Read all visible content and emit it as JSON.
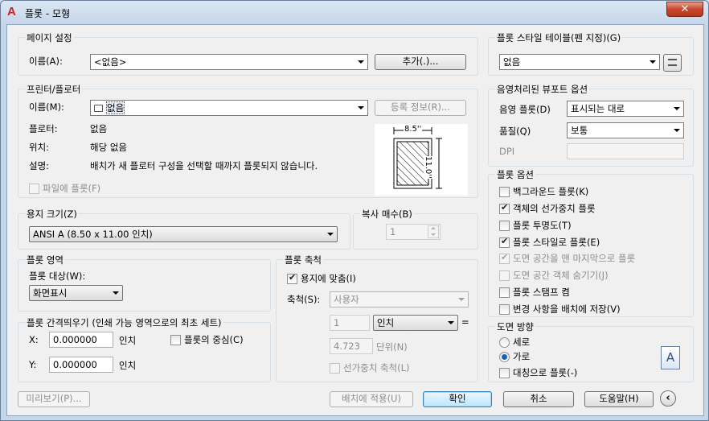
{
  "window": {
    "title": "플롯 - 모형",
    "app_icon": "A",
    "close_label": "✕"
  },
  "page_setup": {
    "group": "페이지 설정",
    "name_label": "이름(A):",
    "name_value": "<없음>",
    "add_button": "추가(.)..."
  },
  "plot_style": {
    "group": "플롯 스타일 테이블(펜 지정)(G)",
    "value": "없음"
  },
  "printer": {
    "group": "프린터/플로터",
    "name_label": "이름(M):",
    "name_value": "없음",
    "properties_button": "등록 정보(R)...",
    "plotter_label": "플로터:",
    "plotter_value": "없음",
    "location_label": "위치:",
    "location_value": "해당 없음",
    "description_label": "설명:",
    "description_value": "배치가 새 플로터 구성을 선택할 때까지 플롯되지 않습니다.",
    "plot_to_file": "파일에 플롯(F)",
    "preview_width": "8.5''",
    "preview_height": "11.0''"
  },
  "shaded": {
    "group": "음영처리된 뷰포트 옵션",
    "shade_label": "음영 플롯(D)",
    "shade_value": "표시되는 대로",
    "quality_label": "품질(Q)",
    "quality_value": "보통",
    "dpi_label": "DPI",
    "dpi_value": ""
  },
  "plot_options": {
    "group": "플롯 옵션",
    "items": [
      {
        "label": "백그라운드 플롯(K)",
        "checked": false,
        "enabled": true
      },
      {
        "label": "객체의 선가중치 플롯",
        "checked": true,
        "enabled": true
      },
      {
        "label": "플롯 투명도(T)",
        "checked": false,
        "enabled": true
      },
      {
        "label": "플롯 스타일로 플롯(E)",
        "checked": true,
        "enabled": true
      },
      {
        "label": "도면 공간을 맨 마지막으로 플롯",
        "checked": true,
        "enabled": false
      },
      {
        "label": "도면 공간 객체 숨기기(J)",
        "checked": false,
        "enabled": false
      },
      {
        "label": "플롯 스탬프 켬",
        "checked": false,
        "enabled": true
      },
      {
        "label": "변경 사항을 배치에 저장(V)",
        "checked": false,
        "enabled": true
      }
    ]
  },
  "paper_size": {
    "group": "용지 크기(Z)",
    "value": "ANSI A (8.50 x 11.00 인치)"
  },
  "copies": {
    "group": "복사 매수(B)",
    "value": "1"
  },
  "plot_area": {
    "group": "플롯 영역",
    "what_label": "플롯 대상(W):",
    "what_value": "화면표시"
  },
  "plot_scale": {
    "group": "플롯 축척",
    "fit_label": "용지에 맞춤(I)",
    "fit_checked": true,
    "scale_label": "축척(S):",
    "scale_value": "사용자",
    "value1": "1",
    "unit": "인치",
    "equals": "=",
    "value2": "4.723",
    "units_label": "단위(N)",
    "lineweights": "선가중치 축척(L)"
  },
  "plot_offset": {
    "group": "플롯 간격띄우기 (인쇄 가능 영역으로의 최초 세트)",
    "x_label": "X:",
    "x_value": "0.000000",
    "x_unit": "인치",
    "y_label": "Y:",
    "y_value": "0.000000",
    "y_unit": "인치",
    "center": "플롯의 중심(C)"
  },
  "orientation": {
    "group": "도면 방향",
    "portrait": "세로",
    "landscape": "가로",
    "selected": "landscape",
    "upside_down": "대칭으로 플롯(-)",
    "icon_letter": "A"
  },
  "buttons": {
    "preview": "미리보기(P)...",
    "apply": "배치에 적용(U)",
    "ok": "확인",
    "cancel": "취소",
    "help": "도움말(H)"
  }
}
